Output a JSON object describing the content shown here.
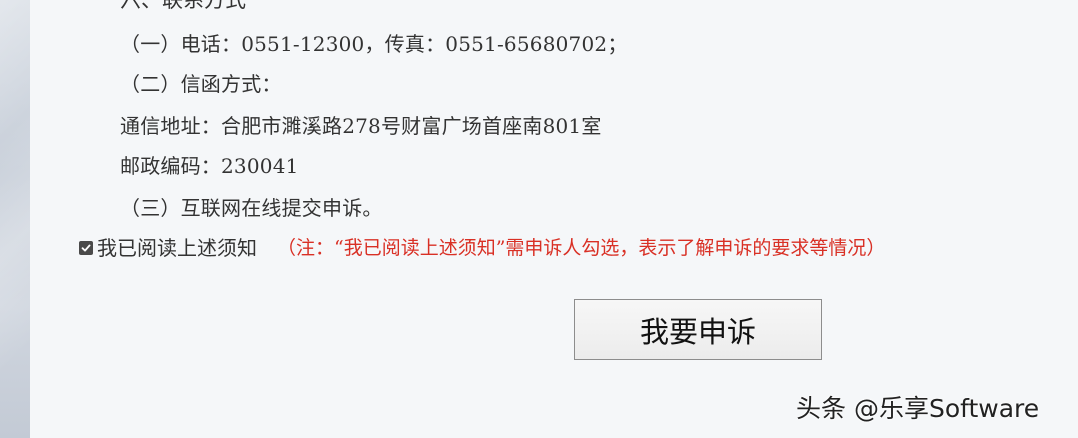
{
  "section": {
    "heading": "六、联系方式",
    "lines": [
      "（一）电话：0551-12300，传真：0551-65680702；",
      "（二）信函方式：",
      "通信地址：合肥市濉溪路278号财富广场首座南801室",
      "邮政编码：230041",
      "（三）互联网在线提交申诉。"
    ]
  },
  "agreement": {
    "checked": true,
    "label": "我已阅读上述须知",
    "note": "（注：“我已阅读上述须知”需申诉人勾选，表示了解申诉的要求等情况）",
    "note_color": "#d93025"
  },
  "submit": {
    "label": "我要申诉"
  },
  "watermark": {
    "text": "头条 @乐享Software"
  }
}
